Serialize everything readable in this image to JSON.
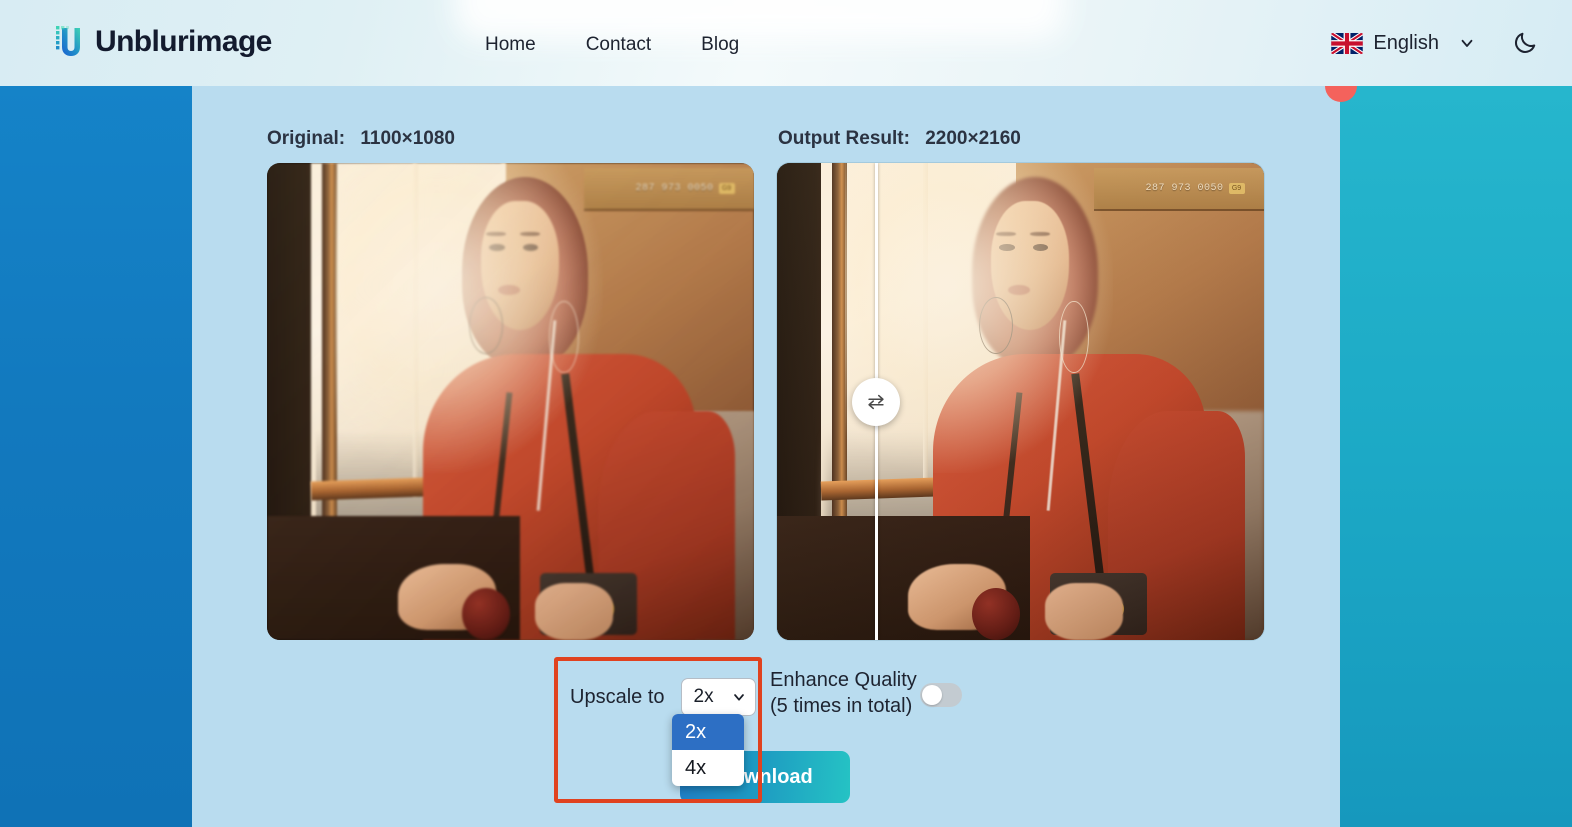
{
  "header": {
    "brand": "Unblurimage",
    "logo_icon": "unblurimage-u-logo",
    "nav": [
      {
        "label": "Home"
      },
      {
        "label": "Contact"
      },
      {
        "label": "Blog"
      }
    ],
    "language": {
      "label": "English",
      "flag_icon": "uk-flag-icon",
      "chevron_icon": "chevron-down-icon"
    },
    "theme_toggle_icon": "moon-icon",
    "colors": {
      "brand_dark": "#131b2e",
      "bg": "#e3f1f5"
    }
  },
  "page": {
    "colors": {
      "left_band": "#1279be",
      "right_band": "#1ca9c6",
      "stage": "#b9dcef",
      "accent_red": "#e0421f",
      "download_gradient_from": "#1f7fc6",
      "download_gradient_to": "#25c3c4",
      "dropdown_selected": "#2d6fc4"
    }
  },
  "compare": {
    "original": {
      "label": "Original:",
      "dimensions": "1100×1080"
    },
    "output": {
      "label": "Output Result:",
      "dimensions": "2200×2160"
    },
    "slider_handle_icon": "swap-arrows-icon",
    "photo": {
      "sign_text": "287 973 0050",
      "sign_badge": "G9"
    }
  },
  "controls": {
    "upscale_label": "Upscale to",
    "upscale_value": "2x",
    "upscale_caret_icon": "chevron-down-icon",
    "upscale_options": [
      {
        "label": "2x",
        "selected": true
      },
      {
        "label": "4x",
        "selected": false
      }
    ],
    "enhance_title": "Enhance Quality",
    "enhance_subtitle": "(5 times in total)",
    "enhance_enabled": "off",
    "download_label": "Download"
  }
}
